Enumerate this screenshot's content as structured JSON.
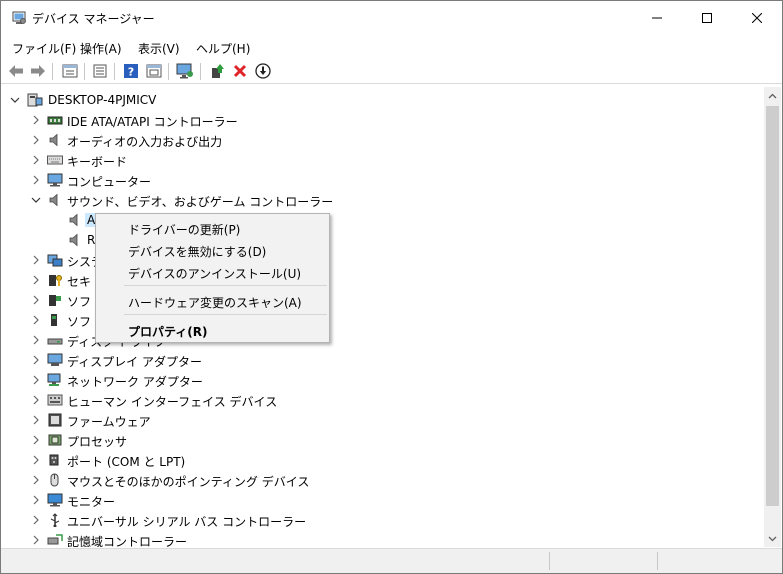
{
  "window": {
    "title": "デバイス マネージャー",
    "controls": {
      "minimize": "—",
      "maximize": "☐",
      "close": "✕"
    }
  },
  "menu": [
    "ファイル(F)",
    "操作(A)",
    "表示(V)",
    "ヘルプ(H)"
  ],
  "toolbar": {
    "buttons": [
      "back-icon",
      "forward-icon",
      "properties-view-icon",
      "list-view-icon",
      "help-icon",
      "show-hidden-icon",
      "monitor-scan-icon",
      "update-driver-icon",
      "uninstall-icon",
      "disable-device-icon"
    ]
  },
  "tree": {
    "root": "DESKTOP-4PJMICV",
    "items": [
      {
        "label": "IDE ATA/ATAPI コントローラー",
        "icon": "ide-icon",
        "expanded": false
      },
      {
        "label": "オーディオの入力および出力",
        "icon": "speaker-icon",
        "expanded": false
      },
      {
        "label": "キーボード",
        "icon": "keyboard-icon",
        "expanded": false
      },
      {
        "label": "コンピューター",
        "icon": "computer-icon",
        "expanded": false
      },
      {
        "label": "サウンド、ビデオ、およびゲーム コントローラー",
        "icon": "speaker-icon",
        "expanded": true
      },
      {
        "label": "A",
        "icon": "speaker-icon",
        "child": true,
        "selected": true
      },
      {
        "label": "R",
        "icon": "speaker-icon",
        "child": true
      },
      {
        "label": "システ",
        "icon": "system-icon",
        "expanded": false
      },
      {
        "label": "セキ",
        "icon": "security-icon",
        "expanded": false
      },
      {
        "label": "ソフト",
        "icon": "software-component-icon",
        "expanded": false
      },
      {
        "label": "ソフト",
        "icon": "software-device-icon",
        "expanded": false
      },
      {
        "label": "ディスク ドライブ",
        "icon": "disk-icon",
        "expanded": false
      },
      {
        "label": "ディスプレイ アダプター",
        "icon": "display-icon",
        "expanded": false
      },
      {
        "label": "ネットワーク アダプター",
        "icon": "network-icon",
        "expanded": false
      },
      {
        "label": "ヒューマン インターフェイス デバイス",
        "icon": "hid-icon",
        "expanded": false
      },
      {
        "label": "ファームウェア",
        "icon": "firmware-icon",
        "expanded": false
      },
      {
        "label": "プロセッサ",
        "icon": "processor-icon",
        "expanded": false
      },
      {
        "label": "ポート (COM と LPT)",
        "icon": "port-icon",
        "expanded": false
      },
      {
        "label": "マウスとそのほかのポインティング デバイス",
        "icon": "mouse-icon",
        "expanded": false
      },
      {
        "label": "モニター",
        "icon": "monitor-icon",
        "expanded": false
      },
      {
        "label": "ユニバーサル シリアル バス コントローラー",
        "icon": "usb-icon",
        "expanded": false
      },
      {
        "label": "記憶域コントローラー",
        "icon": "storage-icon",
        "expanded": false
      }
    ]
  },
  "context_menu": {
    "items": [
      {
        "label": "ドライバーの更新(P)"
      },
      {
        "label": "デバイスを無効にする(D)"
      },
      {
        "label": "デバイスのアンインストール(U)"
      },
      {
        "label": "ハードウェア変更のスキャン(A)"
      },
      {
        "label": "プロパティ(R)",
        "bold": true
      }
    ]
  },
  "colors": {
    "selection": "#cce8ff",
    "help_blue": "#2b5fbd",
    "uninstall_red": "#e0242a",
    "update_green": "#2e9b3c"
  }
}
